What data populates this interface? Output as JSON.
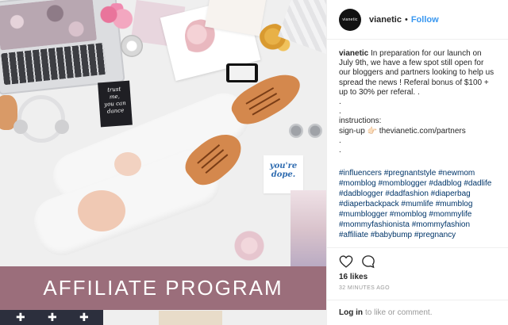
{
  "photo": {
    "card_dark_lines": [
      "trust",
      "me,",
      "you can",
      "dance"
    ],
    "card_dope_lines": [
      "you're",
      "dope."
    ],
    "banner_text": "AFFILIATE PROGRAM"
  },
  "header": {
    "avatar_text": "vianetic",
    "username": "vianetic",
    "separator": "•",
    "follow_label": "Follow"
  },
  "caption": {
    "username": "vianetic",
    "lines": [
      " In preparation for our launch on",
      "July 9th, we have a few spot still open for",
      "our bloggers and partners looking to help us",
      "spread the news ! Referal bonus of $100 +",
      "up to 30% per referal. .",
      ".",
      ".",
      "instructions:",
      "sign-up 👉🏻 thevianetic.com/partners",
      ".",
      "."
    ]
  },
  "hashtags": [
    "#influencers #pregnantstyle #newmom",
    "#momblog #momblogger #dadblog #dadlife",
    "#dadblogger #dadfashion #diaperbag",
    "#diaperbackpack #mumlife #mumblog",
    "#mumblogger #momblog #mommylife",
    "#mommyfashionista #mommyfashion",
    "#affiliate #babybump #pregnancy"
  ],
  "stats": {
    "likes": "16 likes",
    "time": "32 MINUTES AGO"
  },
  "comment": {
    "login_label": "Log in",
    "suffix": "to like or comment."
  },
  "colors": {
    "banner": "#9b6e7b",
    "link": "#3897f0",
    "hashtag": "#003569"
  },
  "icons": [
    "heart-icon",
    "comment-icon"
  ]
}
